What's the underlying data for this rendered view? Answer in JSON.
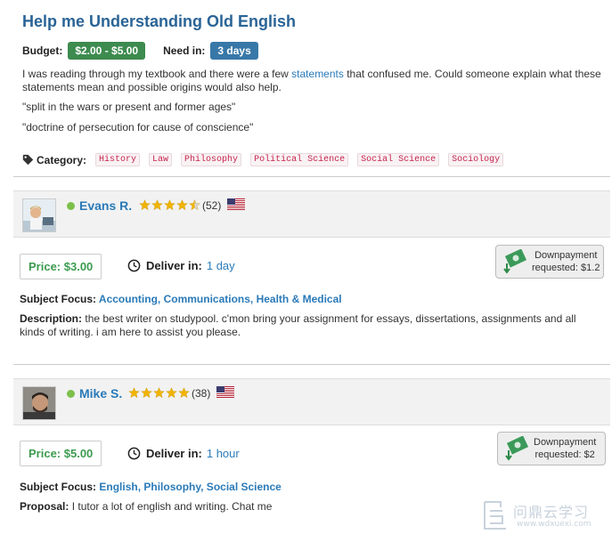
{
  "question": {
    "title": "Help me Understanding Old English",
    "budget_label": "Budget:",
    "budget_value": "$2.00 - $5.00",
    "need_label": "Need in:",
    "need_value": "3 days",
    "description_before_link": "I was reading through my textbook and there were a few ",
    "description_link": "statements",
    "description_after_link": " that confused me. Could someone explain what these statements mean and possible origins would also help.",
    "quote1": "\"split in the wars or present and former ages\"",
    "quote2": "\"doctrine of persecution for cause of conscience\"",
    "category_label": "Category:",
    "categories": [
      "History",
      "Law",
      "Philosophy",
      "Political Science",
      "Social Science",
      "Sociology"
    ]
  },
  "bids": [
    {
      "name": "Evans R.",
      "rating_stars": 4.5,
      "review_count": "(52)",
      "price": "Price: $3.00",
      "deliver_label": "Deliver in:",
      "deliver_value": "1 day",
      "downpayment_line1": "Downpayment",
      "downpayment_line2": "requested: $1.2",
      "subject_label": "Subject Focus:",
      "subject_value": "Accounting, Communications, Health & Medical",
      "desc_label": "Description:",
      "desc_value": "the best writer on studypool. c'mon bring your assignment for essays, dissertations, assignments and all kinds of writing. i am here to assist you please."
    },
    {
      "name": "Mike S.",
      "rating_stars": 5,
      "review_count": "(38)",
      "price": "Price: $5.00",
      "deliver_label": "Deliver in:",
      "deliver_value": "1 hour",
      "downpayment_line1": "Downpayment",
      "downpayment_line2": "requested: $2",
      "subject_label": "Subject Focus:",
      "subject_value": "English, Philosophy, Social Science",
      "desc_label": "Proposal:",
      "desc_value": "I tutor a lot of english and writing. Chat me"
    }
  ],
  "watermark": {
    "text": "问鼎云学习",
    "sub": "www.wdxuexi.com"
  },
  "colors": {
    "link": "#2a7ab8",
    "budget_badge": "#3d8b4f",
    "need_badge": "#3878a8",
    "price": "#3d9b4f",
    "star": "#f0b400",
    "online": "#7cc04b"
  }
}
